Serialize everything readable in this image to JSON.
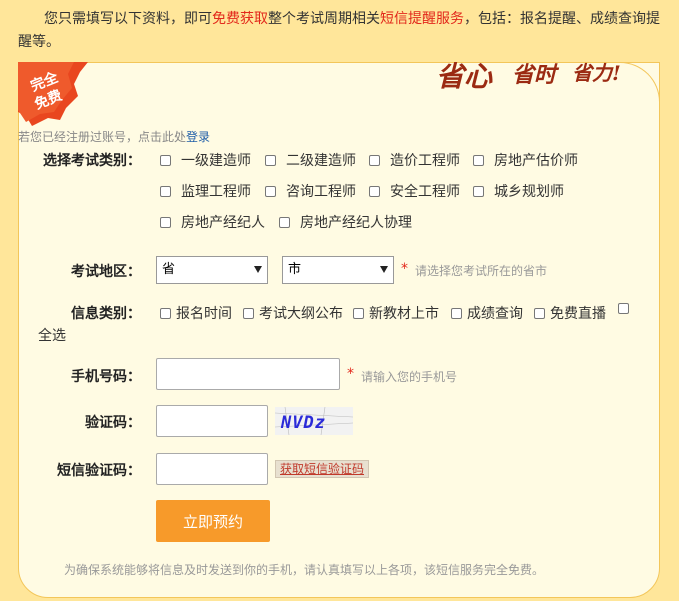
{
  "intro": {
    "part1": "您只需填写以下资料，即可",
    "highlight1": "免费获取",
    "part2": "整个考试周期相关",
    "highlight2": "短信提醒服务",
    "part3": "，包括：报名提醒、成绩查询提醒等。"
  },
  "badge": {
    "line1": "完全",
    "line2": "免费"
  },
  "slogan": {
    "text1": "省心",
    "text2": "省时",
    "text3": "省力!"
  },
  "login_hint": {
    "text": "若您已经注册过账号，点击此处",
    "link": "登录"
  },
  "exam_type": {
    "label": "选择考试类别：",
    "options": [
      "一级建造师",
      "二级建造师",
      "造价工程师",
      "房地产估价师",
      "监理工程师",
      "咨询工程师",
      "安全工程师",
      "城乡规划师",
      "房地产经纪人",
      "房地产经纪人协理"
    ]
  },
  "region": {
    "label": "考试地区：",
    "province": "省",
    "city": "市",
    "star": "*",
    "hint": "请选择您考试所在的省市"
  },
  "info_type": {
    "label": "信息类别：",
    "options": [
      "报名时间",
      "考试大纲公布",
      "新教材上市",
      "成绩查询",
      "免费直播"
    ],
    "select_all": "全选"
  },
  "phone": {
    "label": "手机号码：",
    "star": "*",
    "hint": "请输入您的手机号",
    "value": ""
  },
  "captcha": {
    "label": "验证码：",
    "value": "",
    "image_text": "NVDz"
  },
  "sms": {
    "label": "短信验证码：",
    "value": "",
    "button": "获取短信验证码"
  },
  "submit": {
    "label": "立即预约"
  },
  "footer": {
    "text": "为确保系统能够将信息及时发送到你的手机，请认真填写以上各项，该短信服务完全免费。"
  },
  "colors": {
    "accent": "#f79a2a",
    "highlight": "#e2281b",
    "panel_bg": "#fffbe3",
    "page_bg": "#ffe69a",
    "link": "#1f5ea8"
  }
}
